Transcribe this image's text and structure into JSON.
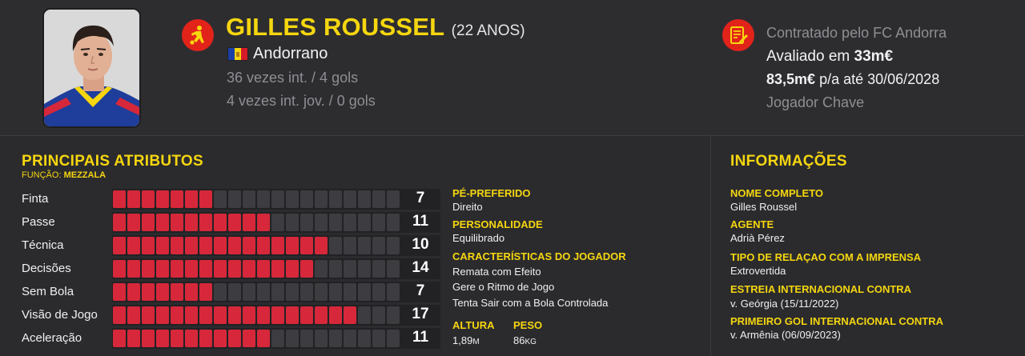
{
  "header": {
    "name": "GILLES ROUSSEL",
    "age": "(22 ANOS)",
    "nationality": "Andorrano",
    "caps": "36 vezes int. / 4 gols",
    "youth_caps": "4 vezes int. jov. / 0 gols",
    "icons": {
      "position": "footballer-icon",
      "contract": "contract-icon",
      "flag": "andorra-flag"
    },
    "contract": {
      "club": "Contratado pelo FC Andorra",
      "value_prefix": "Avaliado em ",
      "value": "33m€",
      "wage": "83,5m€",
      "wage_suffix": " p/a até 30/06/2028",
      "status": "Jogador Chave"
    }
  },
  "attributes": {
    "title": "PRINCIPAIS ATRIBUTOS",
    "role_prefix": "FUNÇÃO: ",
    "role": "MEZZALA",
    "max": 20,
    "items": [
      {
        "label": "Finta",
        "value": 7
      },
      {
        "label": "Passe",
        "value": 11
      },
      {
        "label": "Técnica",
        "value": 10
      },
      {
        "label": "Decisões",
        "value": 14
      },
      {
        "label": "Sem Bola",
        "value": 7
      },
      {
        "label": "Visão de Jogo",
        "value": 17
      },
      {
        "label": "Aceleração",
        "value": 11
      }
    ],
    "filled": [
      7,
      11,
      15,
      14,
      7,
      17,
      11
    ]
  },
  "traits": {
    "foot_label": "PÉ-PREFERIDO",
    "foot": "Direito",
    "personality_label": "PERSONALIDADE",
    "personality": "Equilibrado",
    "characteristics_label": "CARACTERÍSTICAS DO JOGADOR",
    "characteristics": [
      "Remata com Efeito",
      "Gere o Ritmo de Jogo",
      "Tenta Sair com a Bola Controlada"
    ],
    "height_label": "ALTURA",
    "height": "1,89",
    "height_unit": "M",
    "weight_label": "PESO",
    "weight": "86",
    "weight_unit": "KG"
  },
  "info": {
    "title": "INFORMAÇÕES",
    "fields": [
      {
        "label": "NOME COMPLETO",
        "value": "Gilles Roussel"
      },
      {
        "label": "AGENTE",
        "value": "Adrià Pérez"
      },
      {
        "label": "TIPO DE RELAÇAO COM A IMPRENSA",
        "value": "Extrovertida"
      },
      {
        "label": "ESTREIA INTERNACIONAL CONTRA",
        "value": "v. Geórgia (15/11/2022)"
      },
      {
        "label": "PRIMEIRO GOL INTERNACIONAL CONTRA",
        "value": "v. Armênia (06/09/2023)"
      }
    ]
  },
  "colors": {
    "accent": "#f5d60f",
    "bar_on": "#d6283a",
    "bar_off": "#3c3c41",
    "icon_red": "#e2231a",
    "flag": [
      "#1a3fa8",
      "#f5d60f",
      "#d61a2a"
    ]
  }
}
